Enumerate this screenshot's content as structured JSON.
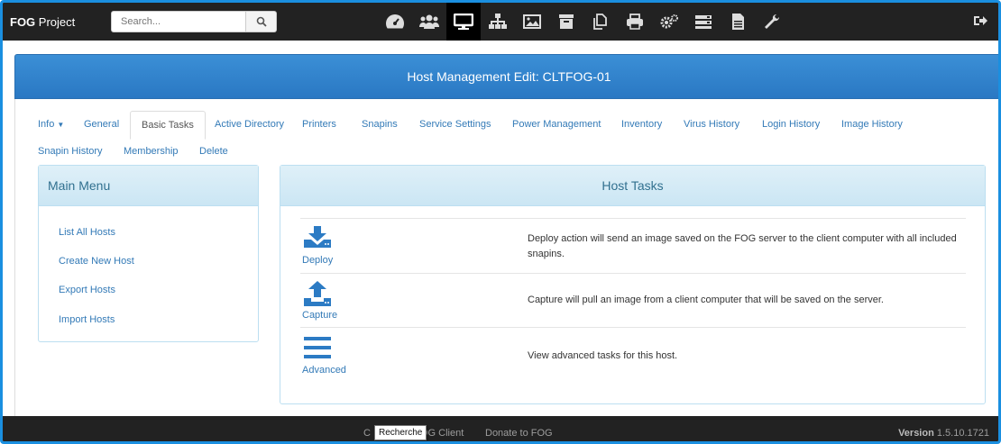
{
  "brand": {
    "bold": "FOG",
    "rest": " Project"
  },
  "search": {
    "placeholder": "Search..."
  },
  "nav_icons": [
    "dashboard-icon",
    "users-icon",
    "hosts-icon",
    "groups-icon",
    "images-icon",
    "storage-icon",
    "snapins-icon",
    "printers-icon",
    "settings-icon",
    "tasks-icon",
    "reports-icon",
    "plugins-icon"
  ],
  "header": {
    "title": "Host Management Edit: CLTFOG-01"
  },
  "tabs": {
    "info": "Info",
    "general": "General",
    "basic_tasks": "Basic Tasks",
    "active_directory": "Active Directory",
    "printers": "Printers",
    "snapins": "Snapins",
    "service_settings": "Service Settings",
    "power_management": "Power Management",
    "inventory": "Inventory",
    "virus_history": "Virus History",
    "login_history": "Login History",
    "image_history": "Image History",
    "snapin_history": "Snapin History",
    "membership": "Membership",
    "delete": "Delete"
  },
  "main_menu": {
    "title": "Main Menu",
    "items": [
      "List All Hosts",
      "Create New Host",
      "Export Hosts",
      "Import Hosts"
    ]
  },
  "host_tasks": {
    "title": "Host Tasks",
    "tasks": [
      {
        "label": "Deploy",
        "desc": "Deploy action will send an image saved on the FOG server to the client computer with all included snapins."
      },
      {
        "label": "Capture",
        "desc": "Capture will pull an image from a client computer that will be saved on the server."
      },
      {
        "label": "Advanced",
        "desc": "View advanced tasks for this host."
      }
    ]
  },
  "footer": {
    "link1": "C",
    "tooltip": "Recherche",
    "link1_rest": "OG Client",
    "link2": "Donate to FOG",
    "version_label": "Version",
    "version": "1.5.10.1721"
  },
  "colors": {
    "accent": "#337ab7",
    "header": "#2a78c3",
    "navbar": "#222222"
  }
}
